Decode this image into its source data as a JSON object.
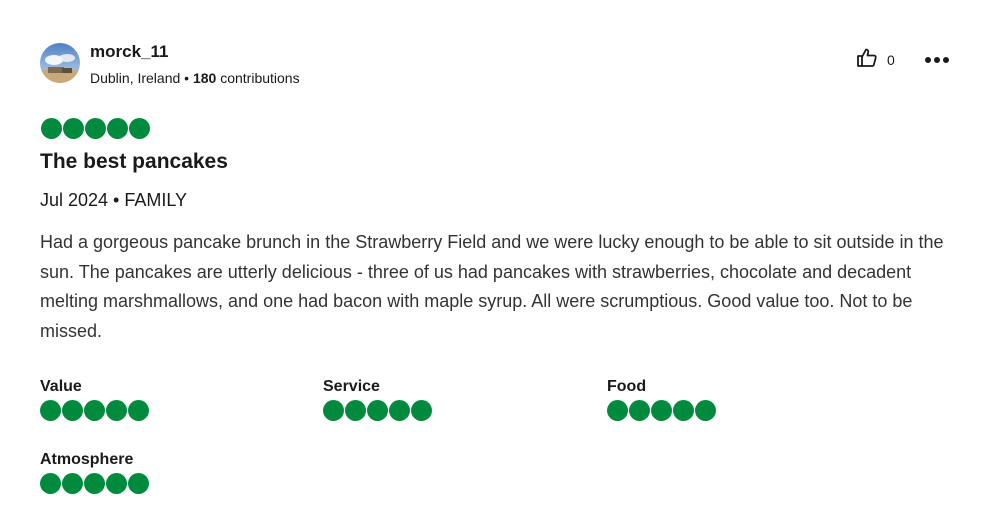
{
  "reviewer": {
    "username": "morck_11",
    "location": "Dublin, Ireland",
    "separator": "•",
    "contributions_count": "180",
    "contributions_label": "contributions"
  },
  "actions": {
    "like_count": "0",
    "like_icon": "thumbs-up-icon",
    "more_icon": "more-horizontal-icon"
  },
  "review": {
    "rating": 5,
    "rating_max": 5,
    "title": "The best pancakes",
    "visit_info": "Jul 2024 • FAMILY",
    "body": "Had a gorgeous pancake brunch in the Strawberry Field and we were lucky enough to be able to sit outside in the sun. The pancakes are utterly delicious - three of us had pancakes with strawberries, chocolate and decadent melting marshmallows, and one had bacon with maple syrup. All were scrumptious. Good value too. Not to be missed."
  },
  "sub_ratings": [
    {
      "label": "Value",
      "rating": 5
    },
    {
      "label": "Service",
      "rating": 5
    },
    {
      "label": "Food",
      "rating": 5
    },
    {
      "label": "Atmosphere",
      "rating": 5
    }
  ],
  "colors": {
    "bubble_fill": "#008a3e",
    "text": "#1a1a1a"
  }
}
